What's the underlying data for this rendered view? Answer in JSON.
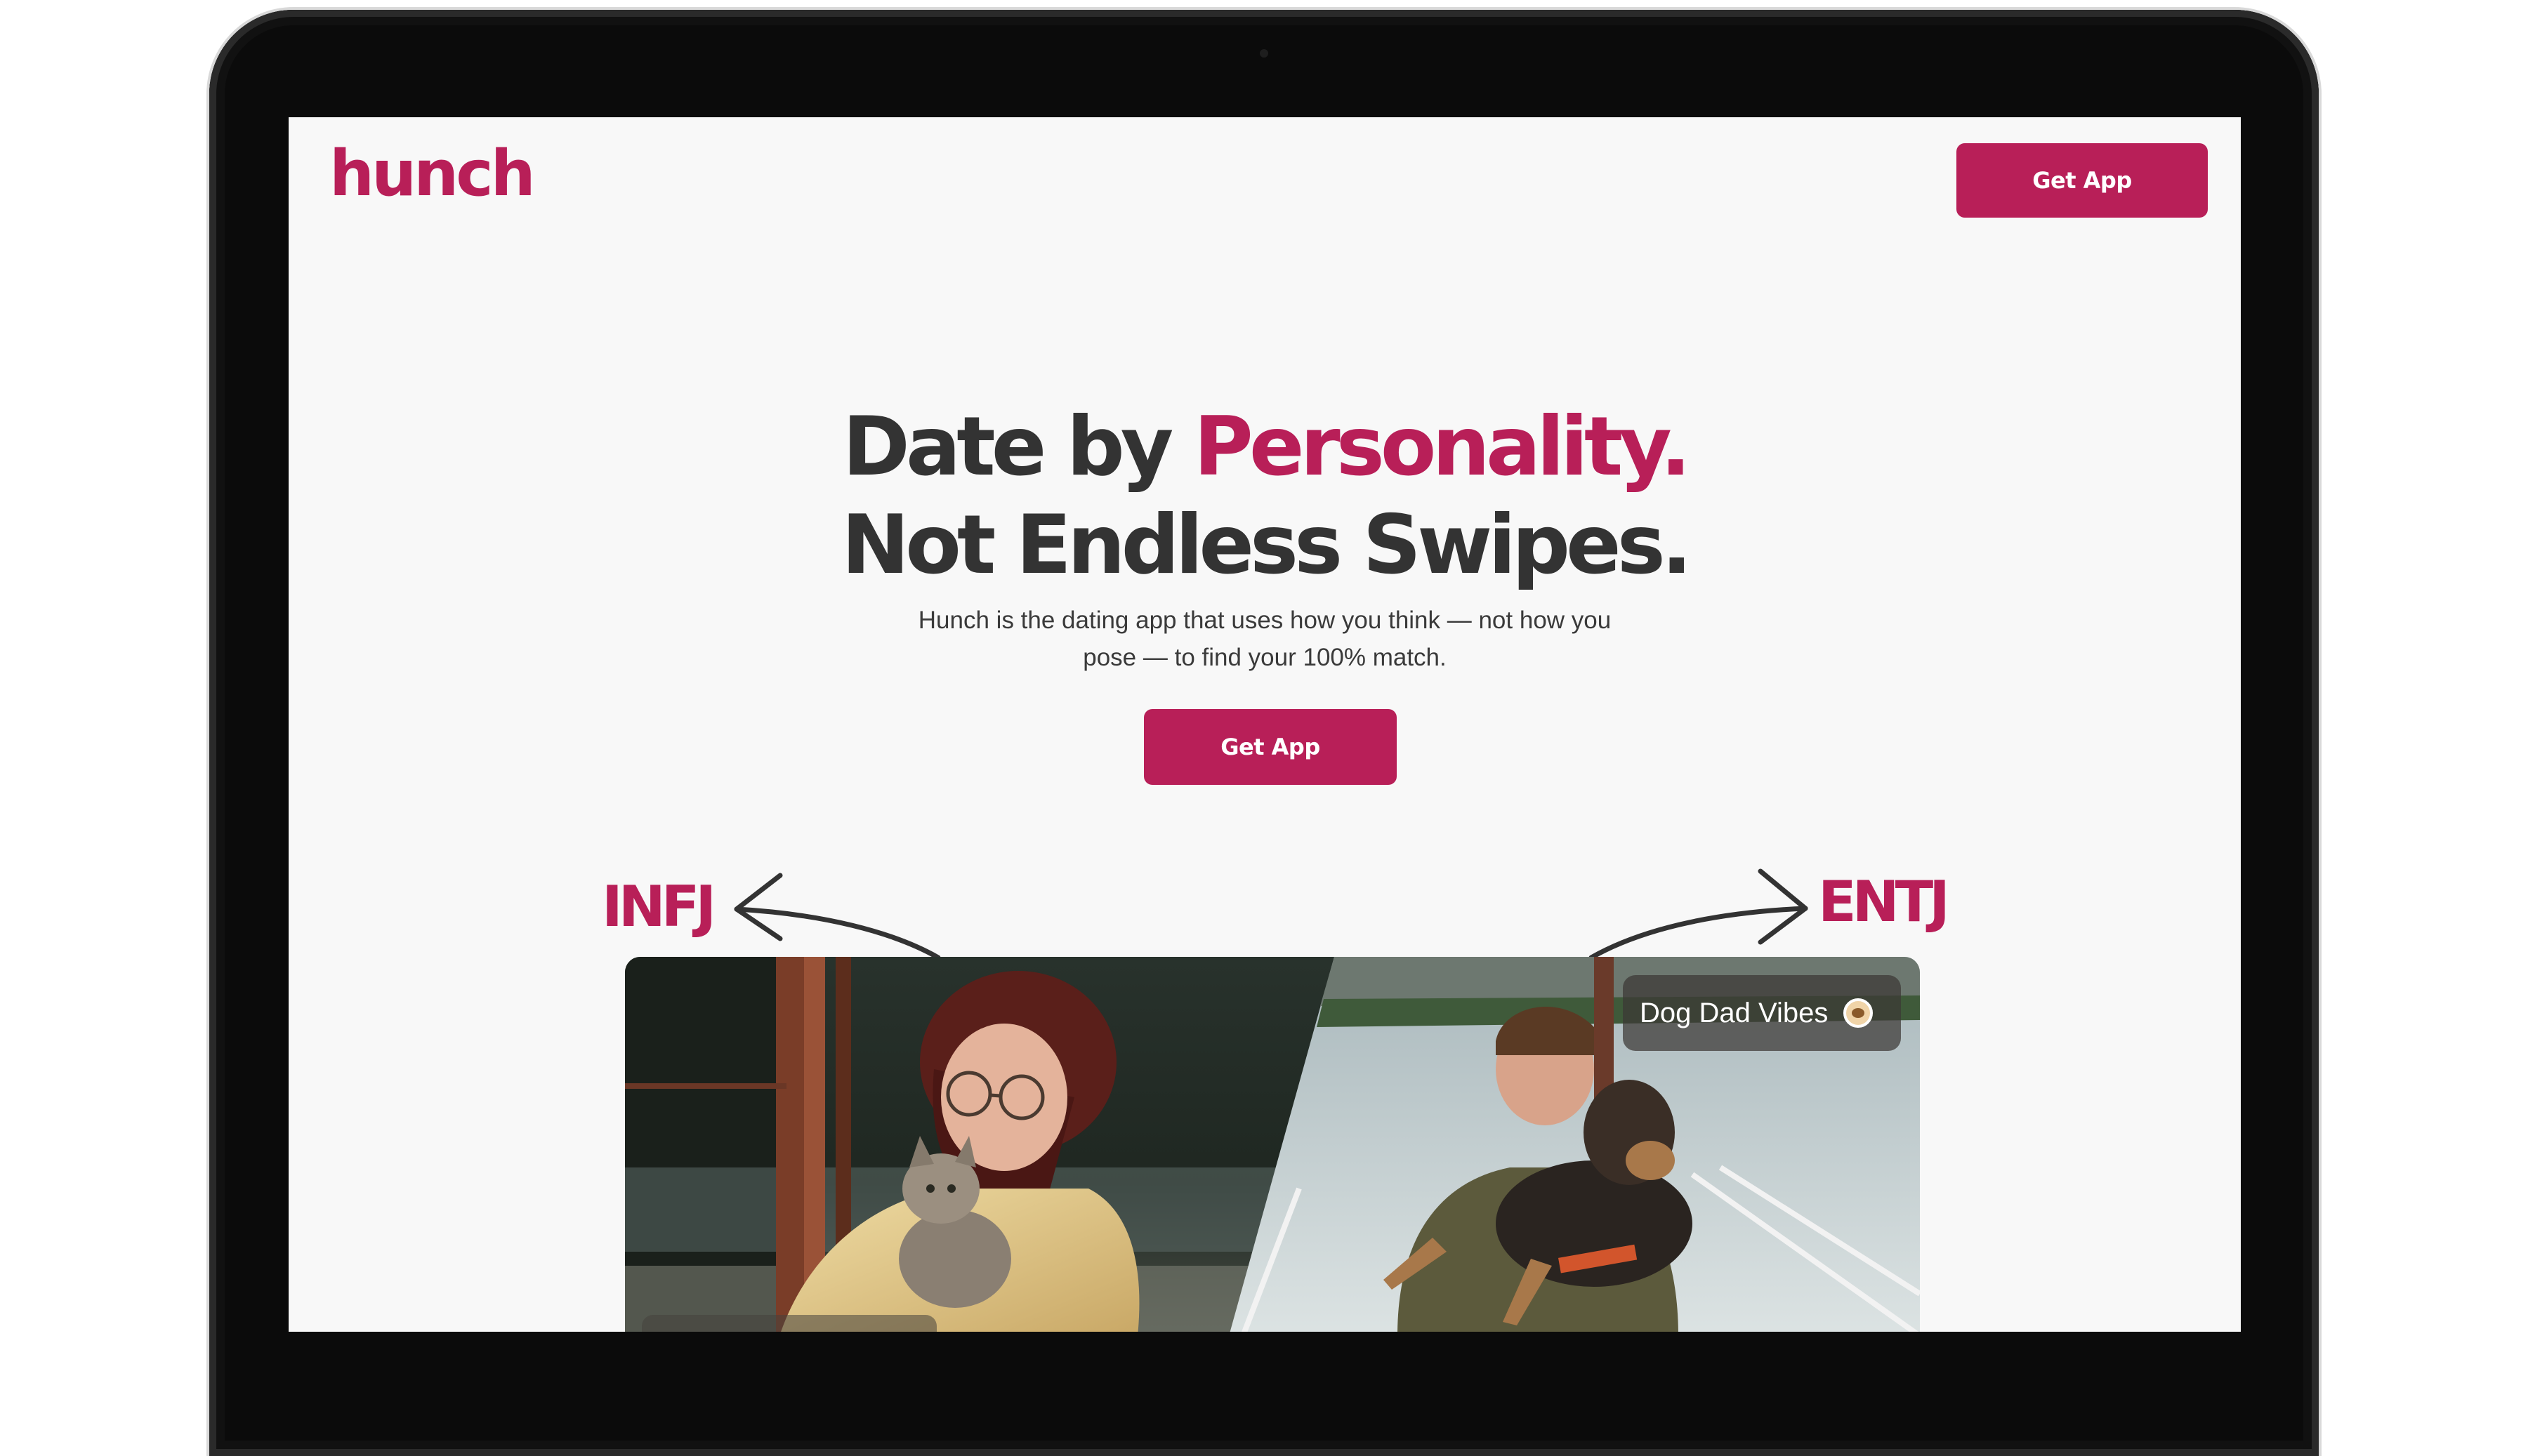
{
  "header": {
    "logo": "hunch",
    "cta_label": "Get App"
  },
  "hero": {
    "title_part1": "Date by ",
    "title_accent": "Personality.",
    "title_line2": "Not Endless Swipes.",
    "subtitle": "Hunch is the dating app that uses how you think — not how you pose — to find your 100% match.",
    "cta_label": "Get App"
  },
  "types": {
    "left": "INFJ",
    "right": "ENTJ"
  },
  "photos": {
    "right_caption": "Dog Dad Vibes"
  },
  "colors": {
    "brand": "#b81f58",
    "heading": "#333333",
    "page_bg": "#f8f8f8"
  }
}
